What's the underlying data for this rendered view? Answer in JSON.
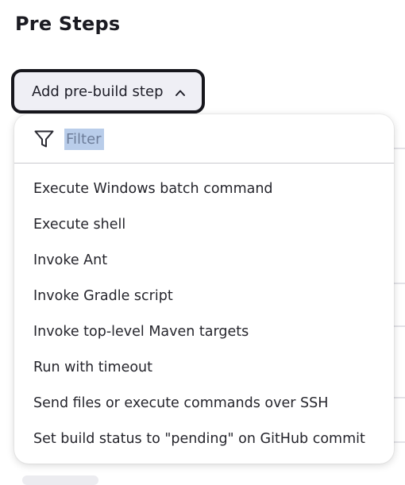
{
  "section": {
    "title": "Pre Steps"
  },
  "add_step_button": {
    "label": "Add pre-build step"
  },
  "dropdown": {
    "filter_placeholder": "Filter",
    "items": [
      {
        "label": "Execute Windows batch command"
      },
      {
        "label": "Execute shell"
      },
      {
        "label": "Invoke Ant"
      },
      {
        "label": "Invoke Gradle script"
      },
      {
        "label": "Invoke top-level Maven targets"
      },
      {
        "label": "Run with timeout"
      },
      {
        "label": "Send files or execute commands over SSH"
      },
      {
        "label": "Set build status to \"pending\" on GitHub commit"
      }
    ]
  },
  "icons": {
    "filter": "filter-funnel-icon",
    "chevron": "chevron-up-icon"
  },
  "colors": {
    "button_bg": "#efeff5",
    "button_border": "#17171d",
    "filter_highlight": "#b9cdea",
    "divider": "#c9c9cf"
  }
}
